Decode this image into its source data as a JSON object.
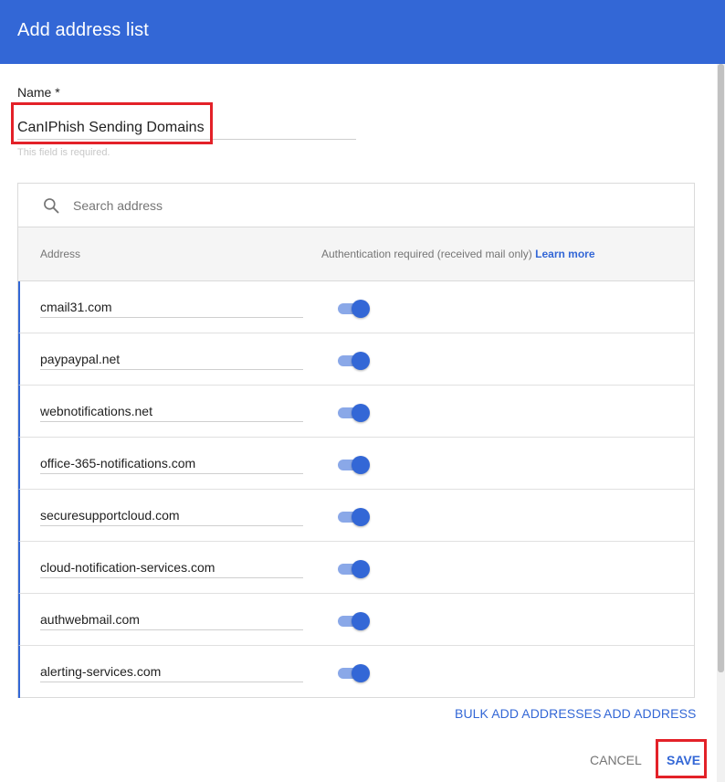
{
  "dialog": {
    "title": "Add address list",
    "name_label": "Name *",
    "name_value": "CanIPhish Sending Domains",
    "name_hint": "This field is required."
  },
  "search": {
    "placeholder": "Search address",
    "icon": "search-icon"
  },
  "table": {
    "col_address": "Address",
    "col_auth": "Authentication required (received mail only)",
    "learn_more": "Learn more",
    "rows": [
      {
        "address": "cmail31.com",
        "auth_required": true
      },
      {
        "address": "paypaypal.net",
        "auth_required": true
      },
      {
        "address": "webnotifications.net",
        "auth_required": true
      },
      {
        "address": "office-365-notifications.com",
        "auth_required": true
      },
      {
        "address": "securesupportcloud.com",
        "auth_required": true
      },
      {
        "address": "cloud-notification-services.com",
        "auth_required": true
      },
      {
        "address": "authwebmail.com",
        "auth_required": true
      },
      {
        "address": "alerting-services.com",
        "auth_required": true
      }
    ]
  },
  "actions": {
    "bulk_add": "BULK ADD ADDRESSES",
    "add": "ADD ADDRESS",
    "cancel": "CANCEL",
    "save": "SAVE"
  },
  "colors": {
    "header": "#3367d6",
    "accent": "#3367d6",
    "highlight": "#e32128"
  }
}
